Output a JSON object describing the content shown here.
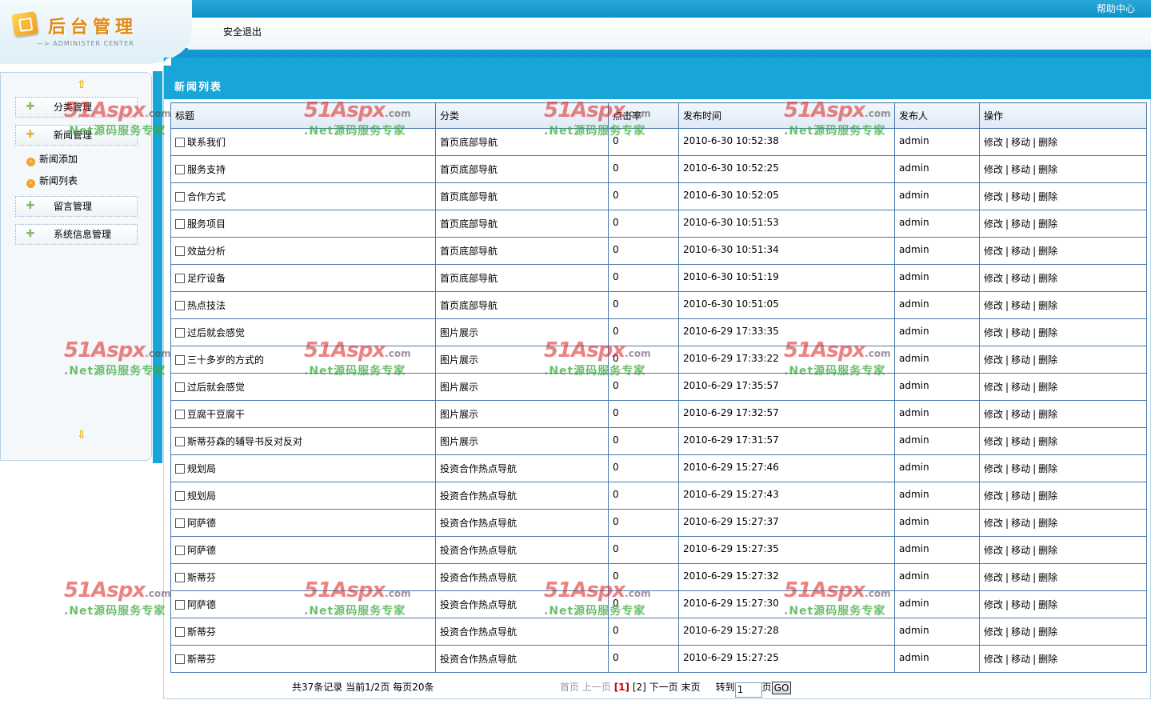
{
  "header": {
    "logo_title": "后台管理",
    "logo_subtitle": "—> ADMINISTER CENTER",
    "help": "帮助中心",
    "logout": "安全退出"
  },
  "sidebar": {
    "menus": [
      {
        "label": "分类管理",
        "icon": "plus-icon"
      },
      {
        "label": "新闻管理",
        "icon": "plus-icon",
        "expanded": true,
        "children": [
          "新闻添加",
          "新闻列表"
        ]
      },
      {
        "label": "留言管理",
        "icon": "plus-icon"
      },
      {
        "label": "系统信息管理",
        "icon": "plus-icon"
      }
    ]
  },
  "panel": {
    "title": "新闻列表"
  },
  "table": {
    "headers": [
      "标题",
      "分类",
      "点击率",
      "发布时间",
      "发布人",
      "操作"
    ],
    "ops": [
      "修改",
      "移动",
      "删除"
    ],
    "rows": [
      {
        "title": "联系我们",
        "category": "首页底部导航",
        "clicks": "0",
        "time": "2010-6-30 10:52:38",
        "author": "admin"
      },
      {
        "title": "服务支持",
        "category": "首页底部导航",
        "clicks": "0",
        "time": "2010-6-30 10:52:25",
        "author": "admin"
      },
      {
        "title": "合作方式",
        "category": "首页底部导航",
        "clicks": "0",
        "time": "2010-6-30 10:52:05",
        "author": "admin"
      },
      {
        "title": "服务项目",
        "category": "首页底部导航",
        "clicks": "0",
        "time": "2010-6-30 10:51:53",
        "author": "admin"
      },
      {
        "title": "效益分析",
        "category": "首页底部导航",
        "clicks": "0",
        "time": "2010-6-30 10:51:34",
        "author": "admin"
      },
      {
        "title": "足疗设备",
        "category": "首页底部导航",
        "clicks": "0",
        "time": "2010-6-30 10:51:19",
        "author": "admin"
      },
      {
        "title": "热点技法",
        "category": "首页底部导航",
        "clicks": "0",
        "time": "2010-6-30 10:51:05",
        "author": "admin"
      },
      {
        "title": "过后就会感觉",
        "category": "图片展示",
        "clicks": "0",
        "time": "2010-6-29 17:33:35",
        "author": "admin"
      },
      {
        "title": "三十多岁的方式的",
        "category": "图片展示",
        "clicks": "0",
        "time": "2010-6-29 17:33:22",
        "author": "admin"
      },
      {
        "title": "过后就会感觉",
        "category": "图片展示",
        "clicks": "0",
        "time": "2010-6-29 17:35:57",
        "author": "admin"
      },
      {
        "title": "豆腐干豆腐干",
        "category": "图片展示",
        "clicks": "0",
        "time": "2010-6-29 17:32:57",
        "author": "admin"
      },
      {
        "title": "斯蒂芬森的辅导书反对反对",
        "category": "图片展示",
        "clicks": "0",
        "time": "2010-6-29 17:31:57",
        "author": "admin"
      },
      {
        "title": "规划局",
        "category": "投资合作热点导航",
        "clicks": "0",
        "time": "2010-6-29 15:27:46",
        "author": "admin"
      },
      {
        "title": "规划局",
        "category": "投资合作热点导航",
        "clicks": "0",
        "time": "2010-6-29 15:27:43",
        "author": "admin"
      },
      {
        "title": "阿萨德",
        "category": "投资合作热点导航",
        "clicks": "0",
        "time": "2010-6-29 15:27:37",
        "author": "admin"
      },
      {
        "title": "阿萨德",
        "category": "投资合作热点导航",
        "clicks": "0",
        "time": "2010-6-29 15:27:35",
        "author": "admin"
      },
      {
        "title": "斯蒂芬",
        "category": "投资合作热点导航",
        "clicks": "0",
        "time": "2010-6-29 15:27:32",
        "author": "admin"
      },
      {
        "title": "阿萨德",
        "category": "投资合作热点导航",
        "clicks": "0",
        "time": "2010-6-29 15:27:30",
        "author": "admin"
      },
      {
        "title": "斯蒂芬",
        "category": "投资合作热点导航",
        "clicks": "0",
        "time": "2010-6-29 15:27:28",
        "author": "admin"
      },
      {
        "title": "斯蒂芬",
        "category": "投资合作热点导航",
        "clicks": "0",
        "time": "2010-6-29 15:27:25",
        "author": "admin"
      }
    ]
  },
  "pager": {
    "summary": "共37条记录 当前1/2页 每页20条",
    "first": "首页",
    "prev": "上一页",
    "current": "[1]",
    "page2": "[2]",
    "next": "下一页",
    "last": "末页",
    "jump_label": "转到",
    "jump_value": "1",
    "page_suffix": "页",
    "go": "GO"
  },
  "watermark": {
    "brand": "51Aspx",
    "domain": ".com",
    "slogan": ".Net源码服务专家"
  },
  "colors": {
    "accent": "#18a5d8",
    "table_border": "#4b79ad",
    "current_page": "#cc0000"
  }
}
